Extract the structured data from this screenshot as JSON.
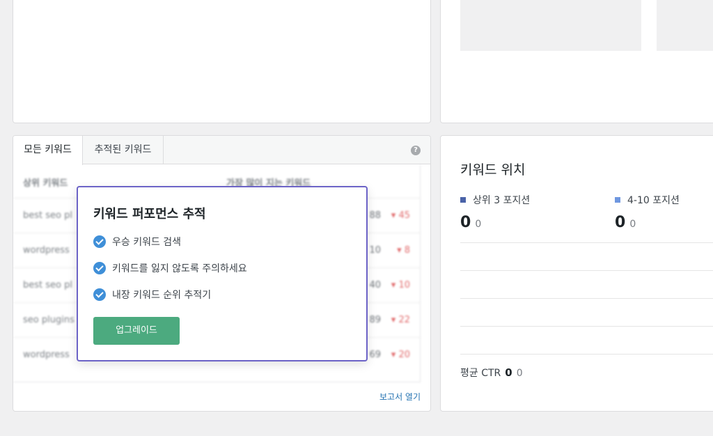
{
  "keywords_card": {
    "tabs": [
      {
        "label": "모든 키워드"
      },
      {
        "label": "추적된 키워드"
      }
    ],
    "help_icon": "?",
    "table": {
      "headers": [
        "상위 키워드",
        "가장 많이 지는 키워드"
      ],
      "rows": [
        {
          "keyword": "best seo pl",
          "volume": "88",
          "change": "▾ 45"
        },
        {
          "keyword": "wordpress",
          "volume": "10",
          "change": "▾ 8"
        },
        {
          "keyword": "best seo pl",
          "volume": "40",
          "change": "▾ 10"
        },
        {
          "keyword": "seo plugins",
          "volume": "89",
          "change": "▾ 22"
        },
        {
          "keyword": "wordpress",
          "volume": "69",
          "change": "▾ 20"
        }
      ]
    },
    "report_link": "보고서 열기"
  },
  "popup": {
    "title": "키워드 퍼포먼스 추적",
    "features": [
      "우승 키워드 검색",
      "키워드를 잃지 않도록 주의하세요",
      "내장 키워드 순위 추적기"
    ],
    "button_label": "업그레이드"
  },
  "positions_card": {
    "title": "키워드 위치",
    "legend": [
      {
        "label": "상위 3 포지션",
        "color": "#4a63a8"
      },
      {
        "label": "4-10 포지션",
        "color": "#6f97e0"
      }
    ],
    "values": [
      {
        "big": "0",
        "small": "0"
      },
      {
        "big": "0",
        "small": "0"
      }
    ],
    "ctr_label": "평균 CTR",
    "ctr_value": "0",
    "ctr_change": "0"
  },
  "colors": {
    "accent_purple": "#6c63c7",
    "check_blue": "#3f8fd8",
    "upgrade_green": "#4caa7f",
    "link_blue": "#2271b1",
    "negative_red": "#d63638"
  }
}
